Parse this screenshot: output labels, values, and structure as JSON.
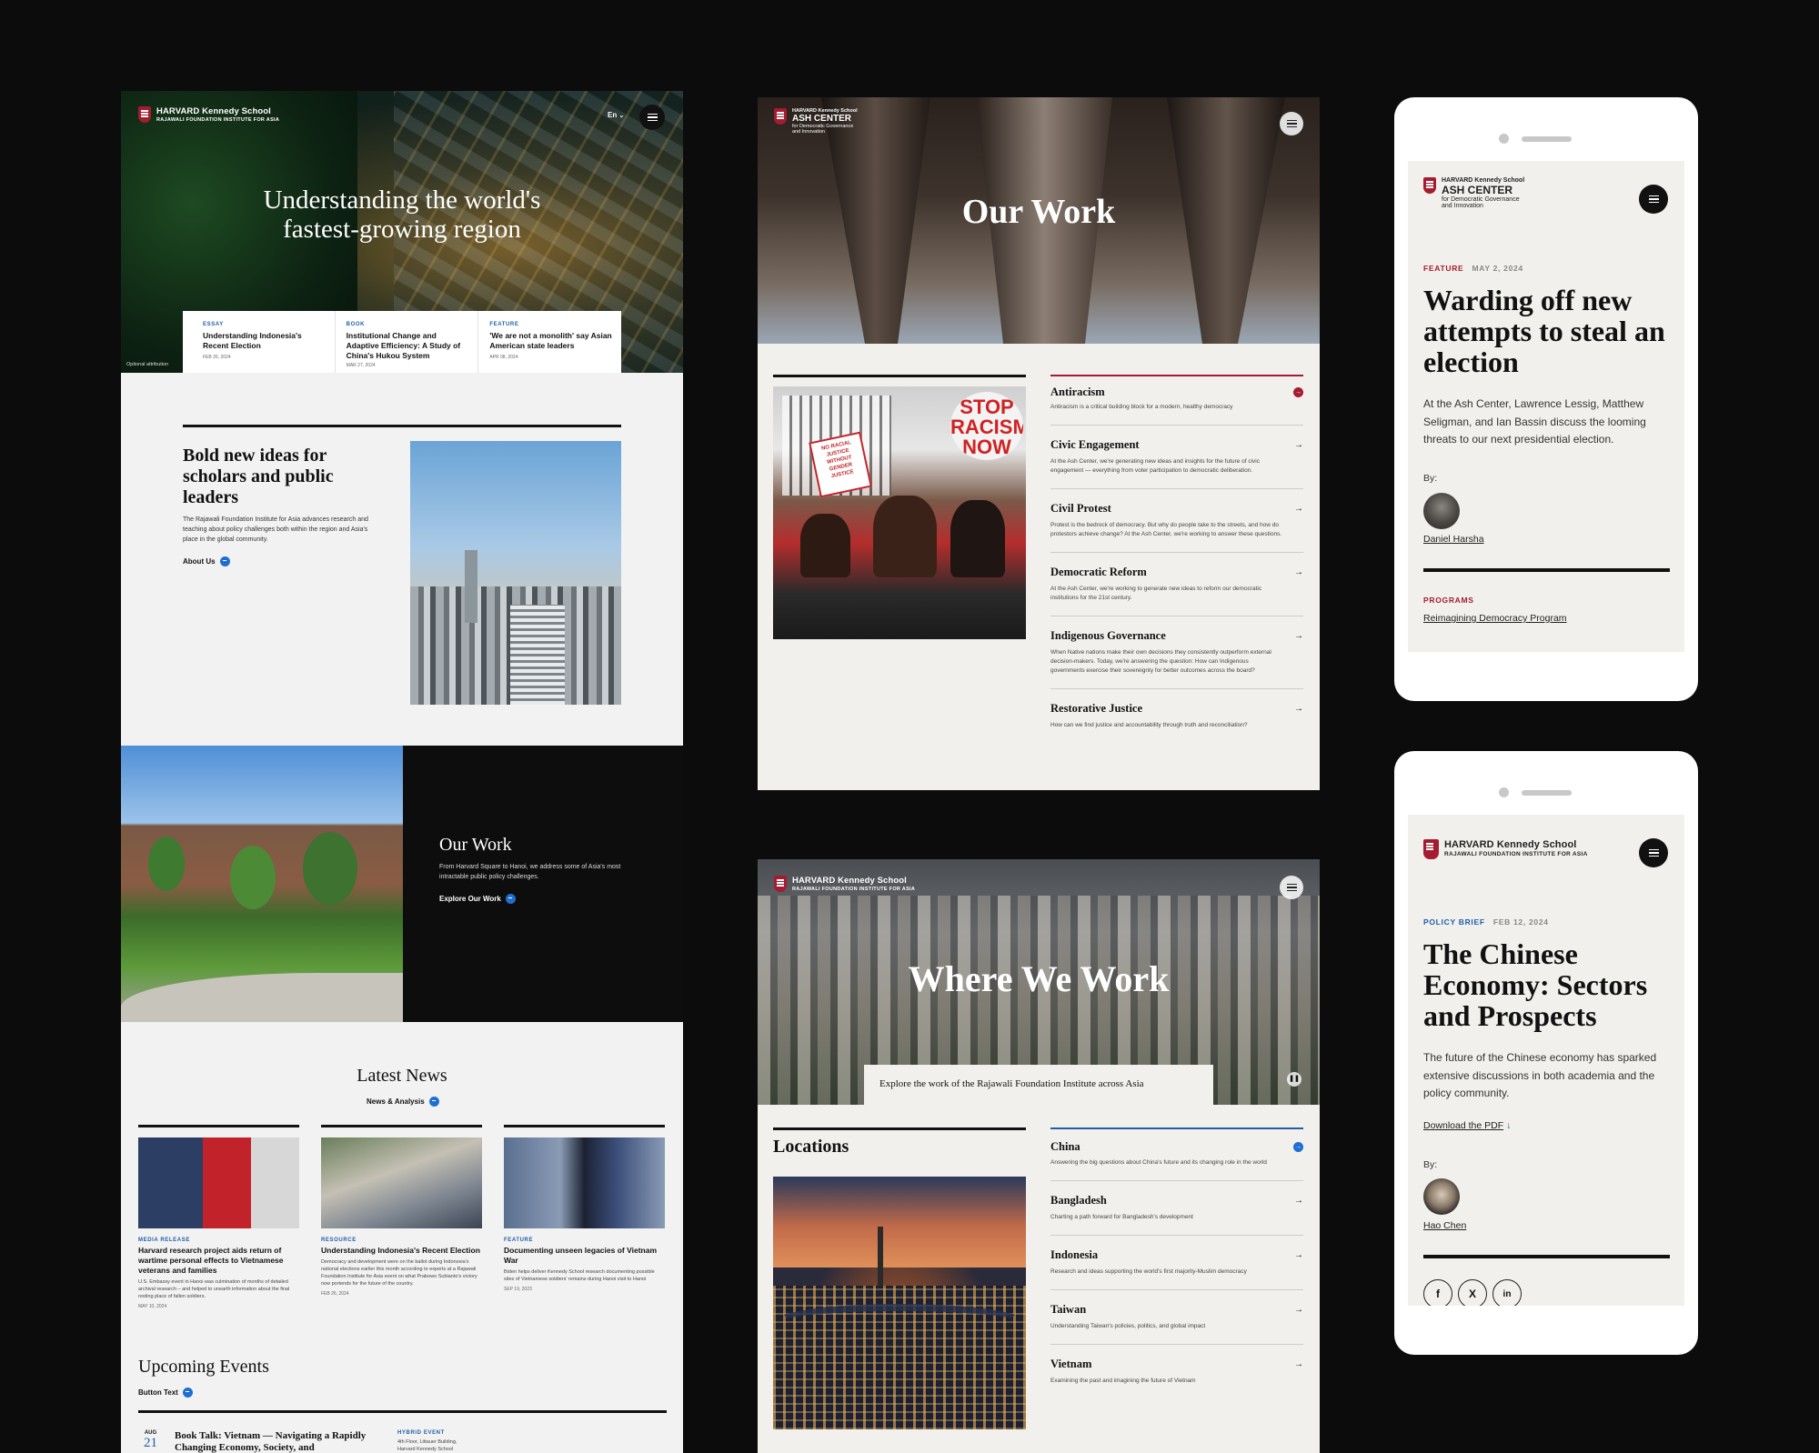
{
  "brand": {
    "hks_main": "HARVARD Kennedy School",
    "rfia_sub": "RAJAWALI FOUNDATION INSTITUTE FOR ASIA",
    "ash_top": "HARVARD Kennedy School",
    "ash_main": "ASH CENTER",
    "ash_sub1": "for Democratic Governance",
    "ash_sub2": "and Innovation"
  },
  "home": {
    "lang": "En",
    "hero_title_1": "Understanding the world's",
    "hero_title_2": "fastest-growing region",
    "attribution": "Optional attribution",
    "cards": [
      {
        "kicker": "ESSAY",
        "title": "Understanding Indonesia's Recent Election",
        "date": "FEB 26, 2024"
      },
      {
        "kicker": "BOOK",
        "title": "Institutional Change and Adaptive Efficiency: A Study of China's Hukou System",
        "date": "MAR 27, 2024"
      },
      {
        "kicker": "FEATURE",
        "title": "'We are not a monolith' say Asian American state leaders",
        "date": "APR 08, 2024"
      }
    ],
    "about_title": "Bold new ideas for scholars and public leaders",
    "about_body": "The Rajawali Foundation Institute for Asia advances research and teaching about policy challenges both within the region and Asia's place in the global community.",
    "about_link": "About Us",
    "ourwork_title": "Our Work",
    "ourwork_body": "From Harvard Square to Hanoi, we address some of Asia's most intractable public policy challenges.",
    "ourwork_link": "Explore Our Work",
    "news_title": "Latest News",
    "news_link": "News & Analysis",
    "news": [
      {
        "kicker": "MEDIA RELEASE",
        "title": "Harvard research project aids return of wartime personal effects to Vietnamese veterans and families",
        "body": "U.S. Embassy event in Hanoi was culmination of months of detailed archival research – and helped to unearth information about the final resting place of fallen soldiers.",
        "date": "MAY 10, 2024"
      },
      {
        "kicker": "RESOURCE",
        "title": "Understanding Indonesia's Recent Election",
        "body": "Democracy and development were on the ballot during Indonesia's national elections earlier this month according to experts at a Rajawali Foundation Institute for Asia event on what Prabowo Subianto's victory now portends for the future of the country.",
        "date": "FEB 26, 2024"
      },
      {
        "kicker": "FEATURE",
        "title": "Documenting unseen legacies of Vietnam War",
        "body": "Biden helps deliver Kennedy School research documenting possible sites of Vietnamese soldiers' remains during Hanoi visit to Hanoi",
        "date": "SEP 19, 2023"
      }
    ],
    "events_title": "Upcoming Events",
    "events_link": "Button Text",
    "event": {
      "month": "AUG",
      "day": "21",
      "title": "Book Talk: Vietnam — Navigating a Rapidly Changing Economy, Society, and",
      "kicker": "HYBRID EVENT",
      "loc": "4th Floor, Littauer Building, Harvard Kennedy School"
    }
  },
  "ourwork": {
    "title": "Our Work",
    "sign": "STOP RACISM NOW",
    "sign_small": "NO RACIAL JUSTICE WITHOUT GENDER JUSTICE",
    "items": [
      {
        "title": "Antiracism",
        "desc": "Antiracism is a critical building block for a modern, healthy democracy"
      },
      {
        "title": "Civic Engagement",
        "desc": "At the Ash Center, we're generating new ideas and insights for the future of civic engagement — everything from voter participation to democratic deliberation."
      },
      {
        "title": "Civil Protest",
        "desc": "Protest is the bedrock of democracy. But why do people take to the streets, and how do protestors achieve change? At the Ash Center, we're working to answer these questions."
      },
      {
        "title": "Democratic Reform",
        "desc": "At the Ash Center, we're working to generate new ideas to reform our democratic institutions for the 21st century."
      },
      {
        "title": "Indigenous Governance",
        "desc": "When Native nations make their own decisions they consistently outperform external decision-makers. Today, we're answering the question: How can Indigenous governments exercise their sovereignty for better outcomes across the board?"
      },
      {
        "title": "Restorative Justice",
        "desc": "How can we find justice and accountability through truth and reconciliation?"
      }
    ]
  },
  "where": {
    "title": "Where We Work",
    "tagline": "Explore the work of the Rajawali Foundation Institute across Asia",
    "locations_title": "Locations",
    "items": [
      {
        "title": "China",
        "desc": "Answering the big questions about China's future and its changing role in the world"
      },
      {
        "title": "Bangladesh",
        "desc": "Charting a path forward for Bangladesh's development"
      },
      {
        "title": "Indonesia",
        "desc": "Research and ideas supporting the world's first majority-Muslim democracy"
      },
      {
        "title": "Taiwan",
        "desc": "Understanding Taiwan's policies, politics, and global impact"
      },
      {
        "title": "Vietnam",
        "desc": "Examining the past and imagining the future of Vietnam"
      }
    ]
  },
  "phone1": {
    "kicker": "FEATURE",
    "date": "MAY 2, 2024",
    "title": "Warding off new attempts to steal an election",
    "body": "At the Ash Center, Lawrence Lessig, Matthew Seligman, and Ian Bassin discuss the looming threats to our next presidential election.",
    "by": "By:",
    "author": "Daniel Harsha",
    "programs_label": "PROGRAMS",
    "program": "Reimagining Democracy Program"
  },
  "phone2": {
    "kicker": "POLICY BRIEF",
    "date": "FEB 12, 2024",
    "title": "The Chinese Economy: Sectors and Prospects",
    "body": "The future of the Chinese economy has sparked extensive discussions in both academia and the policy community.",
    "download": "Download the PDF",
    "by": "By:",
    "author": "Hao Chen",
    "social": [
      "f",
      "X",
      "in"
    ]
  },
  "colors": {
    "accent_red": "#a51c30",
    "accent_blue": "#1f6fd1",
    "page_bg": "#0c0c0c"
  }
}
